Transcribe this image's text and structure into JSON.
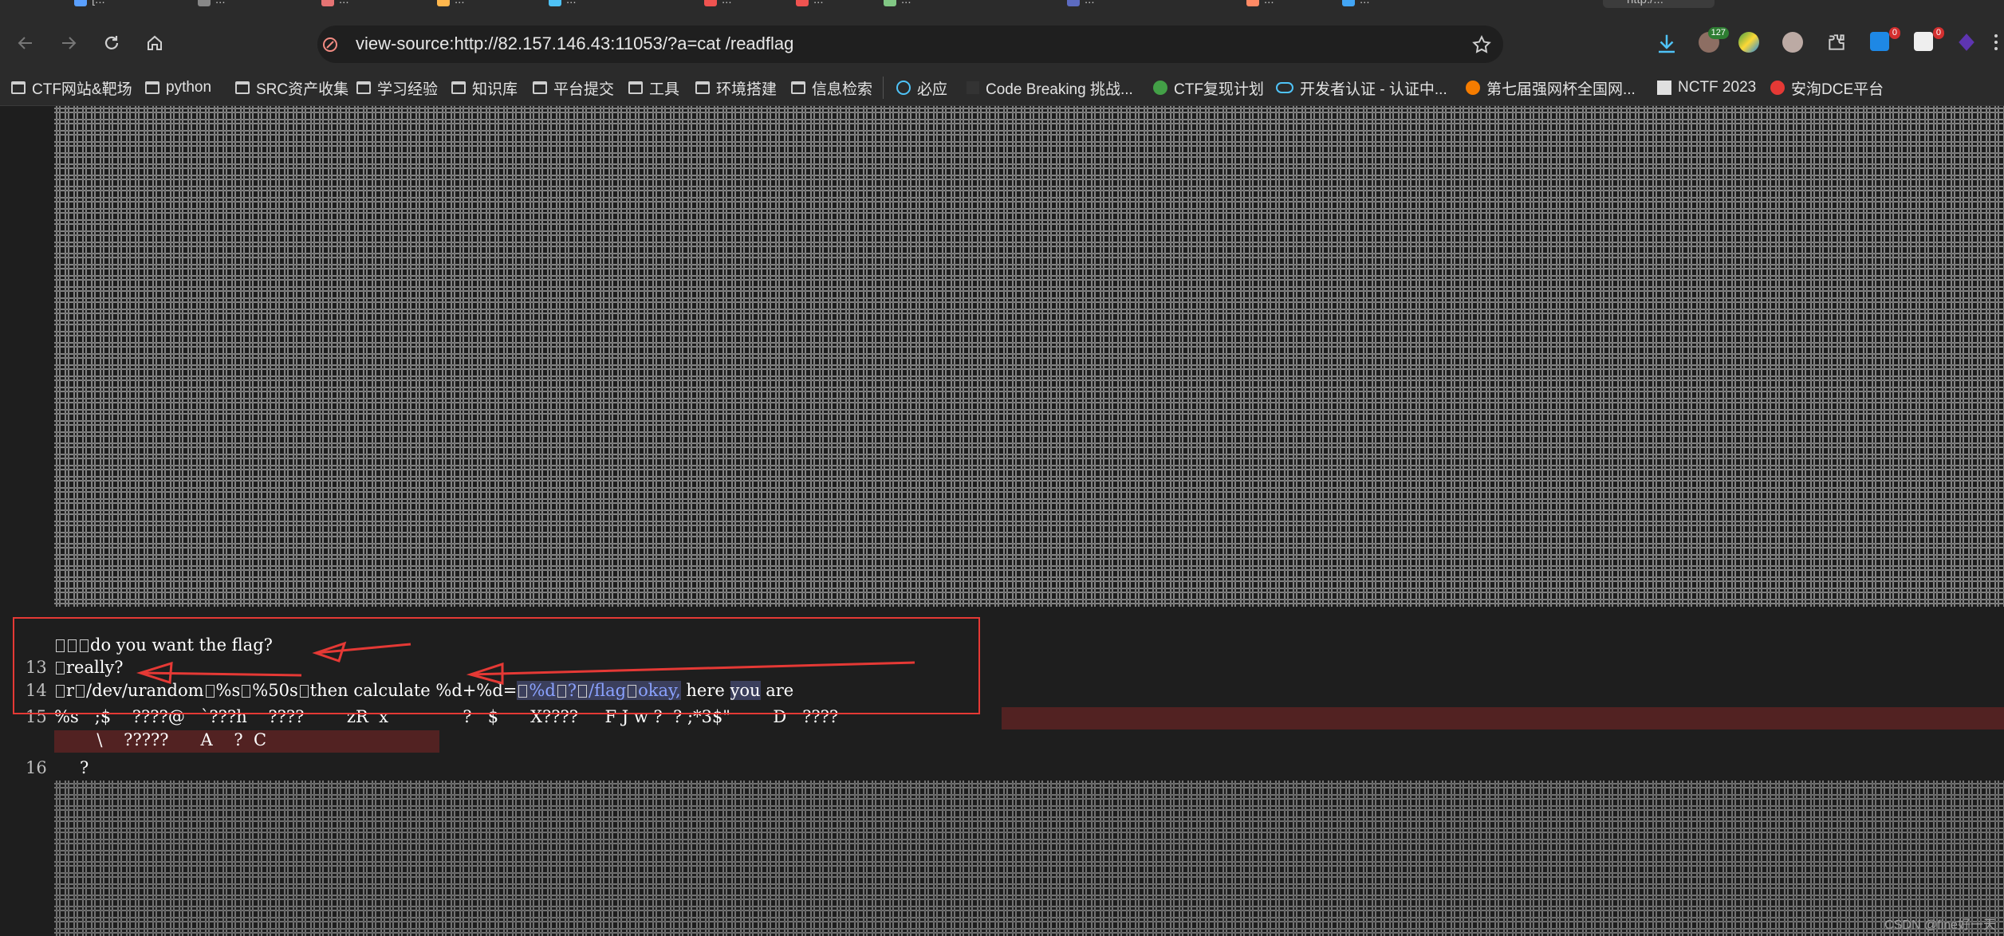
{
  "browser": {
    "url": "view-source:http://82.157.146.43:11053/?a=cat /readflag",
    "tabs": [
      {
        "title": "[...",
        "color": "#5aa0ff"
      },
      {
        "title": "...",
        "color": "#888888"
      },
      {
        "title": "...",
        "color": "#e57373"
      },
      {
        "title": "...",
        "color": "#ffb74d"
      },
      {
        "title": "...",
        "color": "#4fc3f7"
      },
      {
        "title": "...",
        "color": "#ef5350"
      },
      {
        "title": "...",
        "color": "#ef5350"
      },
      {
        "title": "...",
        "color": "#81c784"
      },
      {
        "title": "...",
        "color": "#5c6bc0"
      },
      {
        "title": "...",
        "color": "#ff8a65"
      },
      {
        "title": "...",
        "color": "#42a5f5"
      },
      {
        "title": "http:/...",
        "color": "#9e9e9e"
      }
    ],
    "extension_badges": {
      "downloads": "",
      "ext1": "127",
      "ext2": "0",
      "ext3": "0"
    }
  },
  "bookmarks": [
    {
      "label": "CTF网站&靶场",
      "type": "folder"
    },
    {
      "label": "python",
      "type": "folder"
    },
    {
      "label": "SRC资产收集",
      "type": "folder"
    },
    {
      "label": "学习经验",
      "type": "folder"
    },
    {
      "label": "知识库",
      "type": "folder"
    },
    {
      "label": "平台提交",
      "type": "folder"
    },
    {
      "label": "工具",
      "type": "folder"
    },
    {
      "label": "环境搭建",
      "type": "folder"
    },
    {
      "label": "信息检索",
      "type": "folder"
    },
    {
      "label": "必应",
      "type": "link"
    },
    {
      "label": "Code Breaking 挑战...",
      "type": "link"
    },
    {
      "label": "CTF复现计划",
      "type": "link"
    },
    {
      "label": "开发者认证 - 认证中...",
      "type": "link"
    },
    {
      "label": "第七届强网杯全国网...",
      "type": "link"
    },
    {
      "label": "NCTF 2023",
      "type": "link"
    },
    {
      "label": "安洵DCE平台",
      "type": "link"
    }
  ],
  "source": {
    "line_numbers": [
      "13",
      "14",
      "15",
      "16"
    ],
    "line12": "do you want the flag?",
    "line13": "really?",
    "line14_a": "r",
    "line14_b": "/dev/urandom",
    "line14_c": "%s",
    "line14_d": "%50s",
    "line14_e": "then calculate %d+%d=",
    "line14_f": "%d",
    "line14_g": "?",
    "line14_h": "/flag",
    "line14_i": "okay,",
    "line14_j": " here ",
    "line14_k": "you",
    "line14_l": " are",
    "line15": "%s   ;$    ????@   `???h    ????        zR  x              ?   $      X????     F J w ?  ? ;*3$\"        D   ????",
    "line15b": "        \\    ?????      A    ?  C",
    "line16": "?"
  },
  "watermark": "CSDN @fine好一天"
}
